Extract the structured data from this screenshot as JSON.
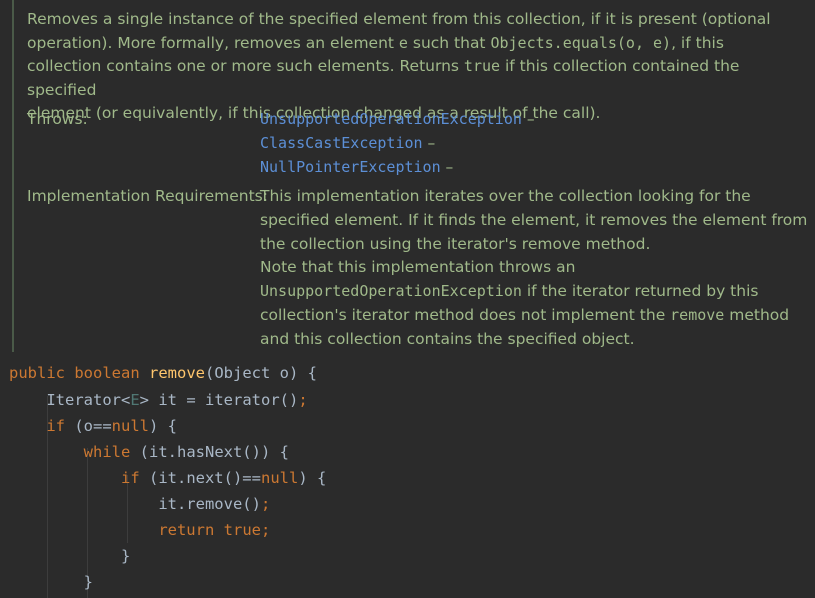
{
  "doc": {
    "description_lines": [
      "Removes a single instance of the specified element from this collection, if it is present (optional",
      "operation). More formally, removes an element ",
      "collection contains one or more such elements. Returns ",
      "element (or equivalently, if this collection changed as a result of the call)."
    ],
    "desc_code_e": "e",
    "desc_text_such_that": " such that ",
    "desc_code_equals": "Objects.equals(o, e)",
    "desc_text_if_this": ", if this",
    "desc_code_true": "true",
    "desc_text_if_contained": " if this collection contained the specified",
    "throws_label": "Throws:",
    "throws": [
      {
        "name": "UnsupportedOperationException",
        "dash": " –"
      },
      {
        "name": "ClassCastException",
        "dash": " –"
      },
      {
        "name": "NullPointerException",
        "dash": " –"
      }
    ],
    "impl_label": "Implementation Requirements:",
    "impl_lines": [
      "This implementation iterates over the collection looking for the",
      "specified element. If it finds the element, it removes the element from",
      "the collection using the iterator's remove method.",
      "Note that this implementation throws an"
    ],
    "impl_code_exception": "UnsupportedOperationException",
    "impl_text_after_exception": " if the iterator returned by this",
    "impl_text_iter_method": "collection's iterator method does not implement the ",
    "impl_code_remove": "remove",
    "impl_text_method": " method",
    "impl_last_line": "and this collection contains the specified object."
  },
  "code": {
    "l1_kw1": "public",
    "l1_kw2": "boolean",
    "l1_fn": "remove",
    "l1_rest": "(Object o) {",
    "l2_type": "Iterator<",
    "l2_gen": "E",
    "l2_rest": "> it = iterator()",
    "l2_semi": ";",
    "l3_kw": "if",
    "l3_mid": " (o==",
    "l3_null": "null",
    "l3_end": ") {",
    "l4_kw": "while",
    "l4_rest": " (it.hasNext()) {",
    "l5_kw": "if",
    "l5_mid": " (it.next()==",
    "l5_null": "null",
    "l5_end": ") {",
    "l6_text": "it.remove()",
    "l6_semi": ";",
    "l7_kw": "return",
    "l7_true": "true",
    "l7_semi": ";",
    "l8": "}",
    "l9": "}"
  },
  "colors": {
    "background": "#2b2b2b",
    "doc_text": "#a0b98a",
    "link": "#5c8fd6",
    "keyword": "#cc7832",
    "function": "#ffc66d",
    "code_text": "#a9b7c6"
  }
}
